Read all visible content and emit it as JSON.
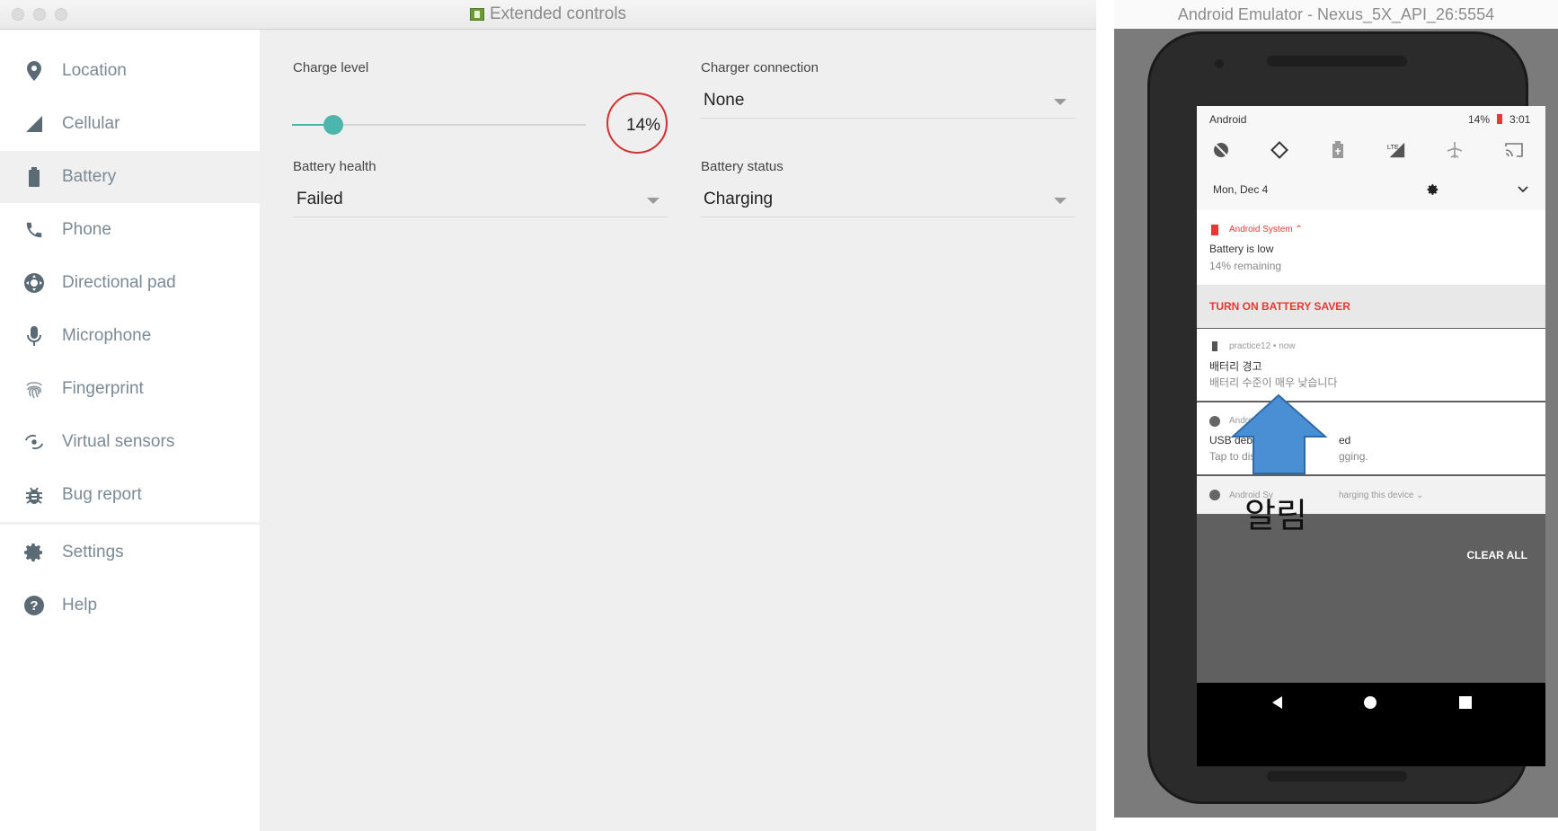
{
  "extended_controls": {
    "window_title": "Extended controls",
    "sidebar": {
      "items": [
        {
          "label": "Location",
          "icon": "location-pin-icon"
        },
        {
          "label": "Cellular",
          "icon": "cellular-signal-icon"
        },
        {
          "label": "Battery",
          "icon": "battery-icon"
        },
        {
          "label": "Phone",
          "icon": "phone-icon"
        },
        {
          "label": "Directional pad",
          "icon": "dpad-icon"
        },
        {
          "label": "Microphone",
          "icon": "microphone-icon"
        },
        {
          "label": "Fingerprint",
          "icon": "fingerprint-icon"
        },
        {
          "label": "Virtual sensors",
          "icon": "rotation-icon"
        },
        {
          "label": "Bug report",
          "icon": "bug-icon"
        },
        {
          "label": "Settings",
          "icon": "gear-icon"
        },
        {
          "label": "Help",
          "icon": "help-icon"
        }
      ],
      "active": "Battery"
    },
    "battery": {
      "charge_level_label": "Charge level",
      "charge_level_value": "14%",
      "charge_level_fraction": 0.14,
      "charger_connection_label": "Charger connection",
      "charger_connection_value": "None",
      "battery_health_label": "Battery health",
      "battery_health_value": "Failed",
      "battery_status_label": "Battery status",
      "battery_status_value": "Charging"
    }
  },
  "emulator": {
    "window_title": "Android Emulator - Nexus_5X_API_26:5554",
    "status": {
      "carrier": "Android",
      "battery": "14%",
      "time": "3:01",
      "date": "Mon, Dec 4"
    },
    "notifications": {
      "system": {
        "app": "Android System ⌃",
        "title": "Battery is low",
        "body": "14% remaining",
        "action": "TURN ON BATTERY SAVER"
      },
      "practice": {
        "app": "practice12 • now",
        "title": "배터리 경고",
        "body": "배터리 수준이 매우 낮습니다"
      },
      "usb": {
        "app": "Android S",
        "title_start": "USB debugging",
        "title_end": "ed",
        "body_start": "Tap to disable U",
        "body_end": "gging."
      },
      "charging": {
        "app_start": "Android Sy",
        "app_end": "harging this device ⌄"
      }
    },
    "clear_all": "CLEAR ALL",
    "annotation_label": "알림",
    "accent": "#e53935"
  }
}
